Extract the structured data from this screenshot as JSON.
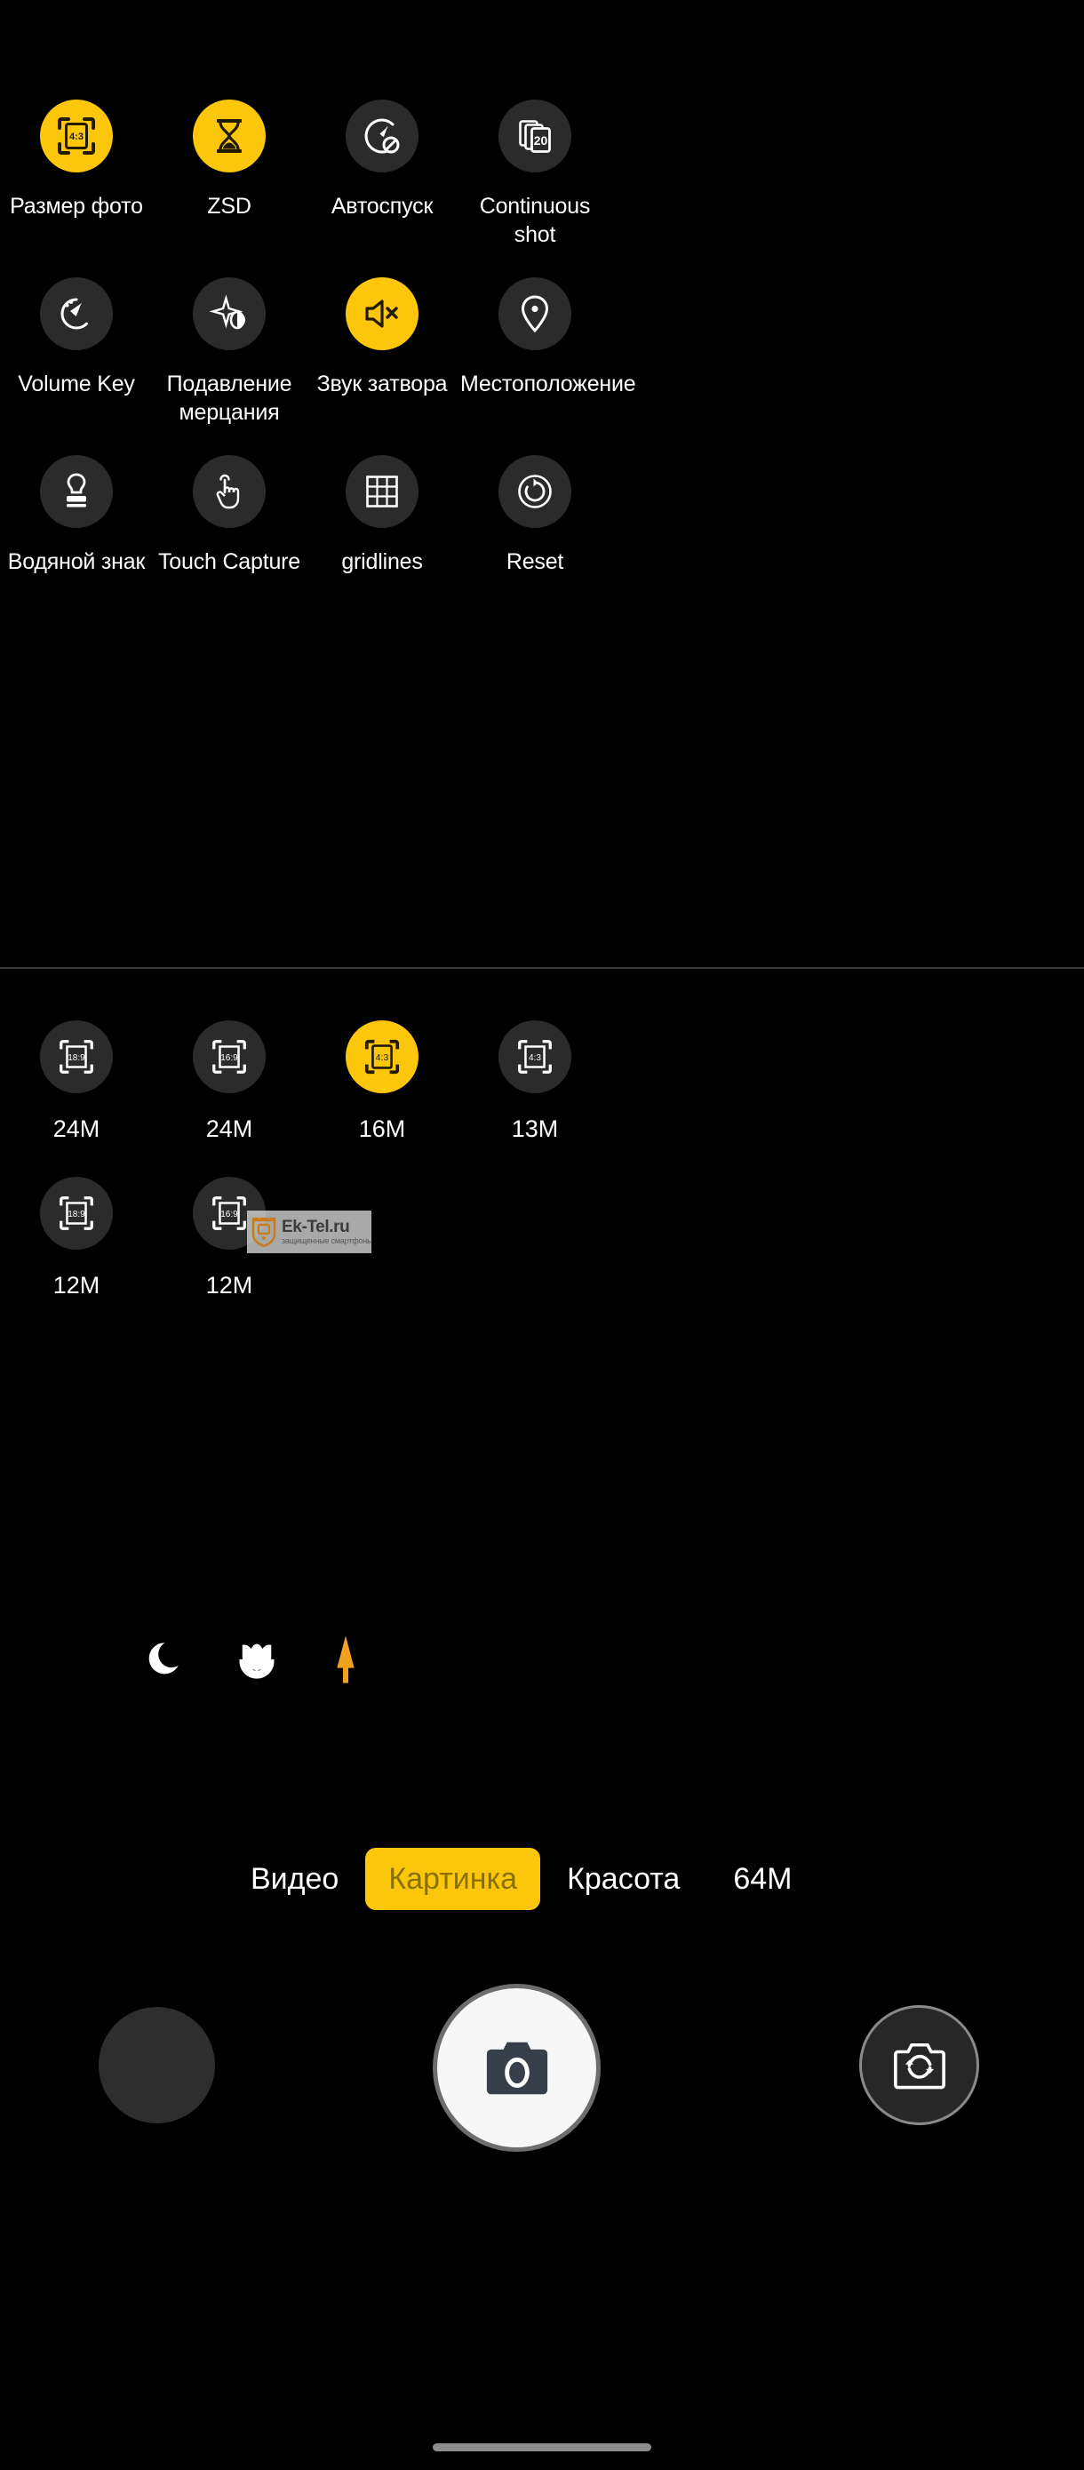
{
  "colors": {
    "background": "#000000",
    "accent_yellow": "#FCC70A",
    "circle_dark": "#2b2b2b",
    "label_white": "#ffffff",
    "divider": "#3a3a3a",
    "selected_mode_text": "#8a7000",
    "scene_active": "#F0A11E"
  },
  "settings": {
    "rows": [
      [
        {
          "label": "Размер фото",
          "icon": "aspect-ratio-4-3-icon",
          "badge": "4:3",
          "active": true
        },
        {
          "label": "ZSD",
          "icon": "hourglass-icon",
          "active": true
        },
        {
          "label": "Автоспуск",
          "icon": "self-timer-off-icon",
          "active": false
        },
        {
          "label": "Continuous shot",
          "icon": "burst-shot-icon",
          "badge": "20",
          "active": false
        }
      ],
      [
        {
          "label": "Volume Key",
          "icon": "volume-key-icon",
          "active": false
        },
        {
          "label": "Подавление мерцания",
          "icon": "anti-flicker-icon",
          "active": false
        },
        {
          "label": "Звук затвора",
          "icon": "shutter-sound-off-icon",
          "active": true
        },
        {
          "label": "Местоположение",
          "icon": "location-pin-icon",
          "active": false
        }
      ],
      [
        {
          "label": "Водяной знак",
          "icon": "watermark-stamp-icon",
          "active": false
        },
        {
          "label": "Touch Capture",
          "icon": "touch-capture-icon",
          "active": false
        },
        {
          "label": "gridlines",
          "icon": "gridlines-icon",
          "active": false
        },
        {
          "label": "Reset",
          "icon": "reset-icon",
          "active": false
        }
      ]
    ]
  },
  "resolutions": {
    "items": [
      {
        "label": "24M",
        "ratio": "18:9",
        "active": false
      },
      {
        "label": "24M",
        "ratio": "16:9",
        "active": false
      },
      {
        "label": "16M",
        "ratio": "4:3",
        "active": true
      },
      {
        "label": "13M",
        "ratio": "4:3",
        "active": false
      },
      {
        "label": "12M",
        "ratio": "18:9",
        "active": false
      },
      {
        "label": "12M",
        "ratio": "16:9",
        "active": false
      }
    ]
  },
  "watermark": {
    "title": "Ek-Tel.ru",
    "subtitle": "защищенные смартфоны"
  },
  "scene_modes": [
    {
      "name": "night-mode-icon",
      "active": false
    },
    {
      "name": "macro-flower-icon",
      "active": false
    },
    {
      "name": "hdr-arrow-icon",
      "active": true
    }
  ],
  "mode_bar": {
    "items": [
      {
        "label": "Видео",
        "selected": false
      },
      {
        "label": "Картинка",
        "selected": true
      },
      {
        "label": "Красота",
        "selected": false
      },
      {
        "label": "64M",
        "selected": false
      }
    ]
  },
  "capture_bar": {
    "gallery": "gallery-thumbnail",
    "shutter": "shutter-camera-icon",
    "flip": "flip-camera-icon"
  }
}
